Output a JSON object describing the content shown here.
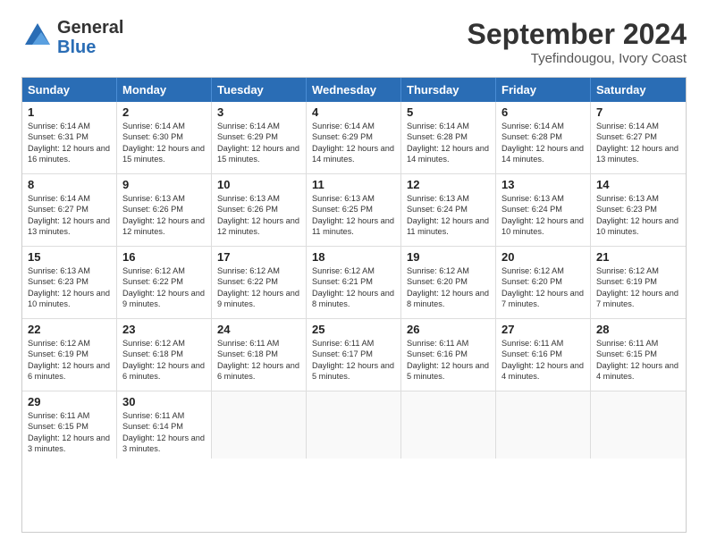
{
  "logo": {
    "general": "General",
    "blue": "Blue"
  },
  "title": "September 2024",
  "location": "Tyefindougou, Ivory Coast",
  "days": [
    "Sunday",
    "Monday",
    "Tuesday",
    "Wednesday",
    "Thursday",
    "Friday",
    "Saturday"
  ],
  "weeks": [
    [
      {
        "day": "1",
        "rise": "6:14 AM",
        "set": "6:31 PM",
        "daylight": "12 hours and 16 minutes."
      },
      {
        "day": "2",
        "rise": "6:14 AM",
        "set": "6:30 PM",
        "daylight": "12 hours and 15 minutes."
      },
      {
        "day": "3",
        "rise": "6:14 AM",
        "set": "6:29 PM",
        "daylight": "12 hours and 15 minutes."
      },
      {
        "day": "4",
        "rise": "6:14 AM",
        "set": "6:29 PM",
        "daylight": "12 hours and 14 minutes."
      },
      {
        "day": "5",
        "rise": "6:14 AM",
        "set": "6:28 PM",
        "daylight": "12 hours and 14 minutes."
      },
      {
        "day": "6",
        "rise": "6:14 AM",
        "set": "6:28 PM",
        "daylight": "12 hours and 14 minutes."
      },
      {
        "day": "7",
        "rise": "6:14 AM",
        "set": "6:27 PM",
        "daylight": "12 hours and 13 minutes."
      }
    ],
    [
      {
        "day": "8",
        "rise": "6:14 AM",
        "set": "6:27 PM",
        "daylight": "12 hours and 13 minutes."
      },
      {
        "day": "9",
        "rise": "6:13 AM",
        "set": "6:26 PM",
        "daylight": "12 hours and 12 minutes."
      },
      {
        "day": "10",
        "rise": "6:13 AM",
        "set": "6:26 PM",
        "daylight": "12 hours and 12 minutes."
      },
      {
        "day": "11",
        "rise": "6:13 AM",
        "set": "6:25 PM",
        "daylight": "12 hours and 11 minutes."
      },
      {
        "day": "12",
        "rise": "6:13 AM",
        "set": "6:24 PM",
        "daylight": "12 hours and 11 minutes."
      },
      {
        "day": "13",
        "rise": "6:13 AM",
        "set": "6:24 PM",
        "daylight": "12 hours and 10 minutes."
      },
      {
        "day": "14",
        "rise": "6:13 AM",
        "set": "6:23 PM",
        "daylight": "12 hours and 10 minutes."
      }
    ],
    [
      {
        "day": "15",
        "rise": "6:13 AM",
        "set": "6:23 PM",
        "daylight": "12 hours and 10 minutes."
      },
      {
        "day": "16",
        "rise": "6:12 AM",
        "set": "6:22 PM",
        "daylight": "12 hours and 9 minutes."
      },
      {
        "day": "17",
        "rise": "6:12 AM",
        "set": "6:22 PM",
        "daylight": "12 hours and 9 minutes."
      },
      {
        "day": "18",
        "rise": "6:12 AM",
        "set": "6:21 PM",
        "daylight": "12 hours and 8 minutes."
      },
      {
        "day": "19",
        "rise": "6:12 AM",
        "set": "6:20 PM",
        "daylight": "12 hours and 8 minutes."
      },
      {
        "day": "20",
        "rise": "6:12 AM",
        "set": "6:20 PM",
        "daylight": "12 hours and 7 minutes."
      },
      {
        "day": "21",
        "rise": "6:12 AM",
        "set": "6:19 PM",
        "daylight": "12 hours and 7 minutes."
      }
    ],
    [
      {
        "day": "22",
        "rise": "6:12 AM",
        "set": "6:19 PM",
        "daylight": "12 hours and 6 minutes."
      },
      {
        "day": "23",
        "rise": "6:12 AM",
        "set": "6:18 PM",
        "daylight": "12 hours and 6 minutes."
      },
      {
        "day": "24",
        "rise": "6:11 AM",
        "set": "6:18 PM",
        "daylight": "12 hours and 6 minutes."
      },
      {
        "day": "25",
        "rise": "6:11 AM",
        "set": "6:17 PM",
        "daylight": "12 hours and 5 minutes."
      },
      {
        "day": "26",
        "rise": "6:11 AM",
        "set": "6:16 PM",
        "daylight": "12 hours and 5 minutes."
      },
      {
        "day": "27",
        "rise": "6:11 AM",
        "set": "6:16 PM",
        "daylight": "12 hours and 4 minutes."
      },
      {
        "day": "28",
        "rise": "6:11 AM",
        "set": "6:15 PM",
        "daylight": "12 hours and 4 minutes."
      }
    ],
    [
      {
        "day": "29",
        "rise": "6:11 AM",
        "set": "6:15 PM",
        "daylight": "12 hours and 3 minutes."
      },
      {
        "day": "30",
        "rise": "6:11 AM",
        "set": "6:14 PM",
        "daylight": "12 hours and 3 minutes."
      },
      null,
      null,
      null,
      null,
      null
    ]
  ]
}
